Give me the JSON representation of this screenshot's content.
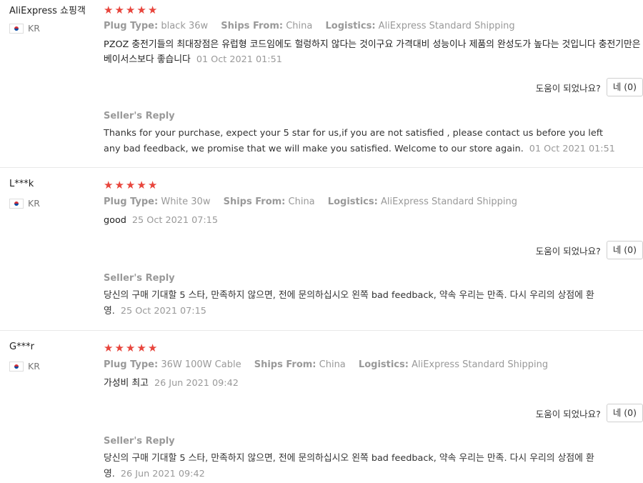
{
  "helpful_label": "도움이 되었나요?",
  "reviews": [
    {
      "user": "AliExpress 쇼핑객",
      "country": "KR",
      "stars": 5,
      "attrs": [
        {
          "key": "Plug Type:",
          "value": "black 36w"
        },
        {
          "key": "Ships From:",
          "value": "China"
        },
        {
          "key": "Logistics:",
          "value": "AliExpress Standard Shipping"
        }
      ],
      "content": "PZOZ 충전기들의 최대장점은 유럽형 코드임에도 헐렁하지 않다는 것이구요 가격대비 성능이나 제품의 완성도가 높다는 것입니다 충전기만은 베이서스보다 좋습니다",
      "timestamp": "01 Oct 2021 01:51",
      "helpful_button": "네 (0)",
      "reply_title": "Seller's Reply",
      "reply_text": "Thanks for your purchase, expect your 5 star for us,if you are not satisfied , please contact us before you left any bad feedback, we promise that we will make you satisfied. Welcome to our store again.",
      "reply_timestamp": "01 Oct 2021 01:51"
    },
    {
      "user": "L***k",
      "country": "KR",
      "stars": 5,
      "attrs": [
        {
          "key": "Plug Type:",
          "value": "White 30w"
        },
        {
          "key": "Ships From:",
          "value": "China"
        },
        {
          "key": "Logistics:",
          "value": "AliExpress Standard Shipping"
        }
      ],
      "content": "good",
      "timestamp": "25 Oct 2021 07:15",
      "helpful_button": "네 (0)",
      "reply_title": "Seller's Reply",
      "reply_text": "당신의 구매 기대할 5 스타, 만족하지 않으면, 전에 문의하십시오 왼쪽 bad feedback, 약속 우리는 만족. 다시 우리의 상점에 환영.",
      "reply_timestamp": "25 Oct 2021 07:15"
    },
    {
      "user": "G***r",
      "country": "KR",
      "stars": 5,
      "attrs": [
        {
          "key": "Plug Type:",
          "value": "36W 100W Cable"
        },
        {
          "key": "Ships From:",
          "value": "China"
        },
        {
          "key": "Logistics:",
          "value": "AliExpress Standard Shipping"
        }
      ],
      "content": "가성비 최고",
      "timestamp": "26 Jun 2021 09:42",
      "helpful_button": "네 (0)",
      "reply_title": "Seller's Reply",
      "reply_text": "당신의 구매 기대할 5 스타, 만족하지 않으면, 전에 문의하십시오 왼쪽 bad feedback, 약속 우리는 만족. 다시 우리의 상점에 환영.",
      "reply_timestamp": "26 Jun 2021 09:42"
    }
  ]
}
